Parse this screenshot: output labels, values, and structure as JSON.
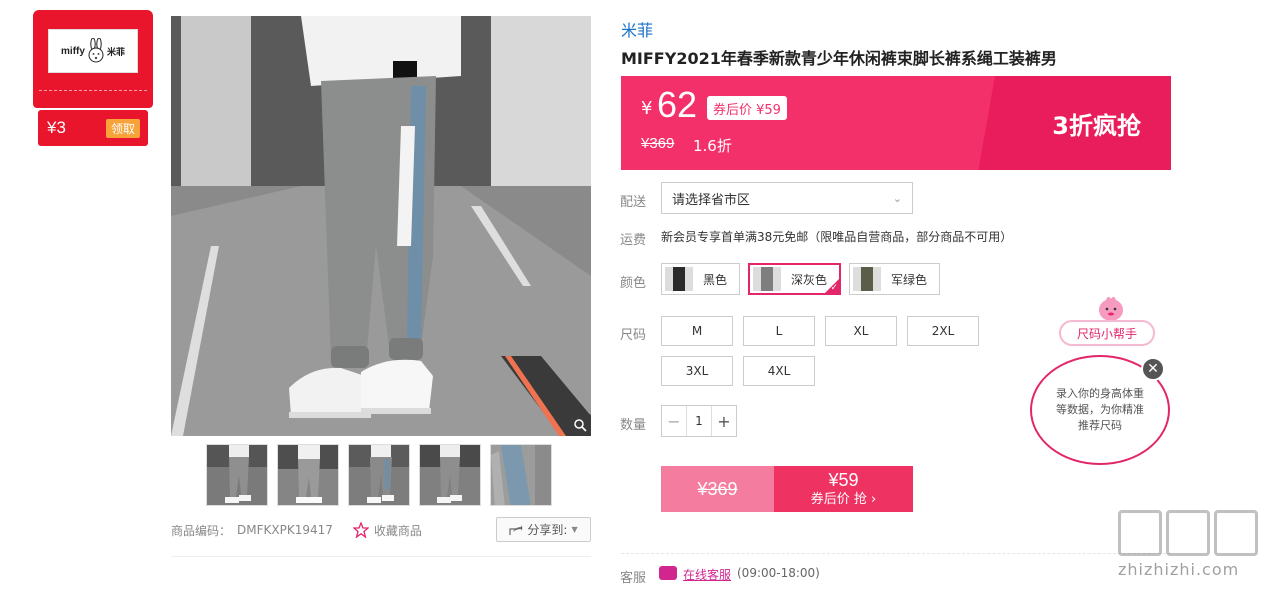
{
  "coupon": {
    "logo_text": "miffy",
    "logo_cn": "米菲",
    "amount": "¥3",
    "claim_label": "领取"
  },
  "product": {
    "brand": "米菲",
    "title": "MIFFY2021年春季新款青少年休闲裤束脚长裤系绳工装裤男",
    "code_label": "商品编码：",
    "code": "DMFKXPK19417",
    "favorite_label": "收藏商品",
    "share_label": "分享到:"
  },
  "price": {
    "currency": "¥",
    "current": "62",
    "after_coupon": "券后价 ¥59",
    "original": "¥369",
    "discount": "1.6折",
    "promo": "3折疯抢"
  },
  "options": {
    "delivery_label": "配送",
    "delivery_placeholder": "请选择省市区",
    "shipping_label": "运费",
    "shipping_text": "新会员专享首单满38元免邮（限唯品自营商品，部分商品不可用）",
    "color_label": "颜色",
    "colors": [
      "黑色",
      "深灰色",
      "军绿色"
    ],
    "selected_color": "深灰色",
    "size_label": "尺码",
    "sizes": [
      "M",
      "L",
      "XL",
      "2XL",
      "3XL",
      "4XL"
    ],
    "qty_label": "数量",
    "qty": "1"
  },
  "buy": {
    "original": "¥369",
    "price": "¥59",
    "sub": "券后价 抢 ›"
  },
  "service": {
    "label": "客服",
    "link": "在线客服",
    "hours": "(09:00-18:00)"
  },
  "helper": {
    "tag": "尺码小帮手",
    "bubble": "录入你的身高体重等数据，为你精准推荐尺码"
  },
  "watermark": {
    "text": "zhizhizhi.com"
  },
  "colors": {
    "accent": "#f3306a",
    "brand_link": "#1a73c9",
    "coupon_red": "#e8152c"
  }
}
